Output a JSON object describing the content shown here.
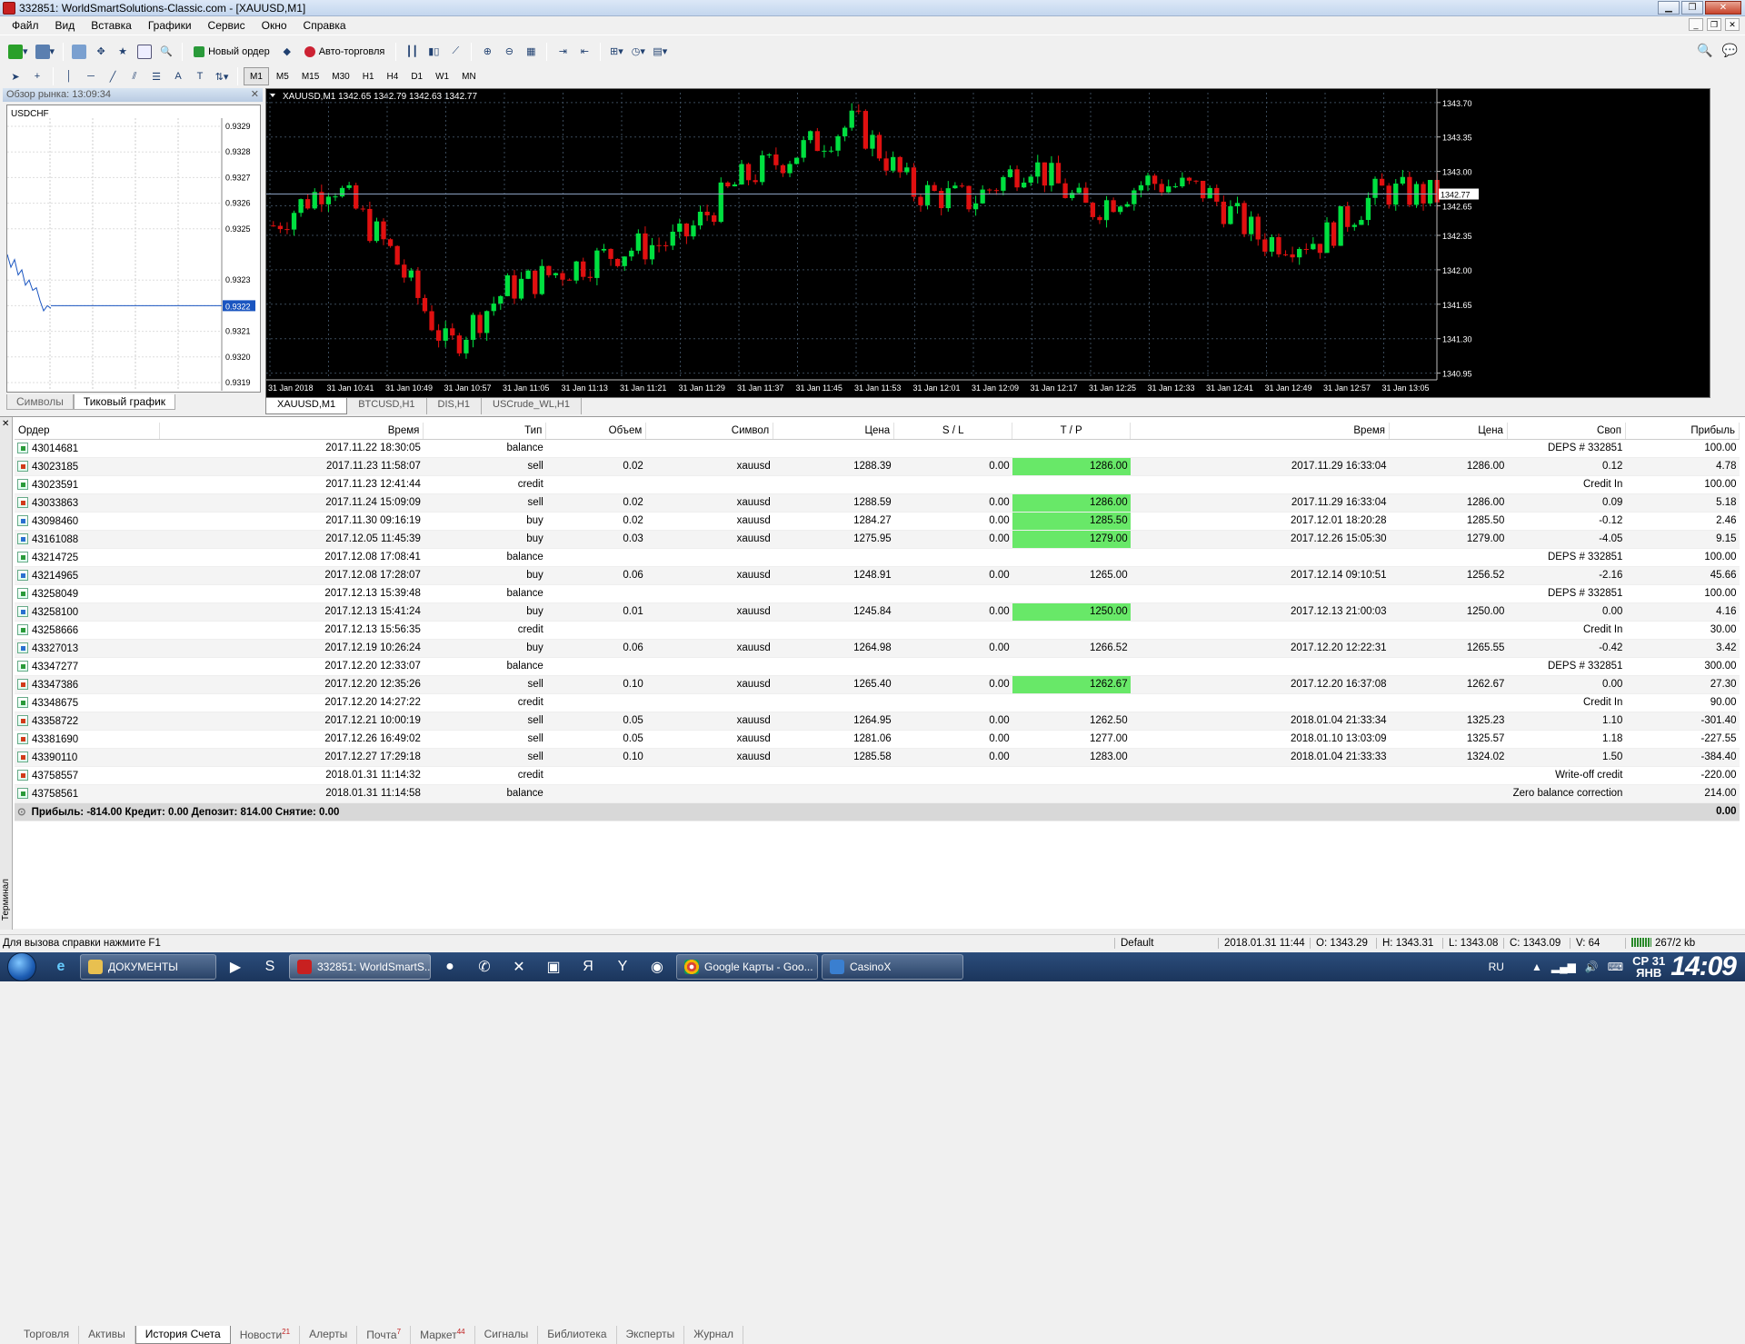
{
  "window": {
    "title": "332851: WorldSmartSolutions-Classic.com - [XAUUSD,M1]"
  },
  "menu": [
    "Файл",
    "Вид",
    "Вставка",
    "Графики",
    "Сервис",
    "Окно",
    "Справка"
  ],
  "toolbar": {
    "new_order": "Новый ордер",
    "auto_trading": "Авто-торговля"
  },
  "timeframes": [
    "M1",
    "M5",
    "M15",
    "M30",
    "H1",
    "H4",
    "D1",
    "W1",
    "MN"
  ],
  "market_watch": {
    "header": "Обзор рынка: 13:09:34",
    "symbol": "USDCHF",
    "price_ticks": [
      "0.9329",
      "0.9328",
      "0.9327",
      "0.9326",
      "0.9325",
      "0.9323",
      "0.9322",
      "0.9321",
      "0.9320",
      "0.9319"
    ],
    "current_price": "0.9322",
    "tabs": [
      "Символы",
      "Тиковый график"
    ]
  },
  "chart": {
    "header": "XAUUSD,M1  1342.65 1342.79 1342.63 1342.77",
    "price_labels": [
      "1343.70",
      "1343.35",
      "1343.00",
      "1342.77",
      "1342.65",
      "1342.35",
      "1342.00",
      "1341.65",
      "1341.30",
      "1340.95"
    ],
    "time_labels": [
      "31 Jan 2018",
      "31 Jan 10:41",
      "31 Jan 10:49",
      "31 Jan 10:57",
      "31 Jan 11:05",
      "31 Jan 11:13",
      "31 Jan 11:21",
      "31 Jan 11:29",
      "31 Jan 11:37",
      "31 Jan 11:45",
      "31 Jan 11:53",
      "31 Jan 12:01",
      "31 Jan 12:09",
      "31 Jan 12:17",
      "31 Jan 12:25",
      "31 Jan 12:33",
      "31 Jan 12:41",
      "31 Jan 12:49",
      "31 Jan 12:57",
      "31 Jan 13:05"
    ],
    "tabs": [
      "XAUUSD,M1",
      "BTCUSD,H1",
      "DIS,H1",
      "USCrude_WL,H1"
    ],
    "colors": {
      "up": "#00e040",
      "down": "#e01010",
      "grid": "#3a4a5a",
      "bid": "#8aa0c0"
    }
  },
  "history": {
    "columns": [
      "Ордер",
      "Время",
      "Тип",
      "Объем",
      "Символ",
      "Цена",
      "S / L",
      "T / P",
      "Время",
      "Цена",
      "Своп",
      "Прибыль"
    ],
    "rows": [
      {
        "order": "43014681",
        "time": "2017.11.22 18:30:05",
        "type": "balance",
        "vol": "",
        "sym": "",
        "price": "",
        "sl": "",
        "tp": "",
        "ctime": "",
        "cprice": "",
        "swap": "DEPS # 332851",
        "profit": "100.00",
        "icon": "bal",
        "hl": false
      },
      {
        "order": "43023185",
        "time": "2017.11.23 11:58:07",
        "type": "sell",
        "vol": "0.02",
        "sym": "xauusd",
        "price": "1288.39",
        "sl": "0.00",
        "tp": "1286.00",
        "ctime": "2017.11.29 16:33:04",
        "cprice": "1286.00",
        "swap": "0.12",
        "profit": "4.78",
        "icon": "sell",
        "hl": true
      },
      {
        "order": "43023591",
        "time": "2017.11.23 12:41:44",
        "type": "credit",
        "vol": "",
        "sym": "",
        "price": "",
        "sl": "",
        "tp": "",
        "ctime": "",
        "cprice": "",
        "swap": "Credit In",
        "profit": "100.00",
        "icon": "bal",
        "hl": false
      },
      {
        "order": "43033863",
        "time": "2017.11.24 15:09:09",
        "type": "sell",
        "vol": "0.02",
        "sym": "xauusd",
        "price": "1288.59",
        "sl": "0.00",
        "tp": "1286.00",
        "ctime": "2017.11.29 16:33:04",
        "cprice": "1286.00",
        "swap": "0.09",
        "profit": "5.18",
        "icon": "sell",
        "hl": true
      },
      {
        "order": "43098460",
        "time": "2017.11.30 09:16:19",
        "type": "buy",
        "vol": "0.02",
        "sym": "xauusd",
        "price": "1284.27",
        "sl": "0.00",
        "tp": "1285.50",
        "ctime": "2017.12.01 18:20:28",
        "cprice": "1285.50",
        "swap": "-0.12",
        "profit": "2.46",
        "icon": "buy",
        "hl": true
      },
      {
        "order": "43161088",
        "time": "2017.12.05 11:45:39",
        "type": "buy",
        "vol": "0.03",
        "sym": "xauusd",
        "price": "1275.95",
        "sl": "0.00",
        "tp": "1279.00",
        "ctime": "2017.12.26 15:05:30",
        "cprice": "1279.00",
        "swap": "-4.05",
        "profit": "9.15",
        "icon": "buy",
        "hl": true
      },
      {
        "order": "43214725",
        "time": "2017.12.08 17:08:41",
        "type": "balance",
        "vol": "",
        "sym": "",
        "price": "",
        "sl": "",
        "tp": "",
        "ctime": "",
        "cprice": "",
        "swap": "DEPS # 332851",
        "profit": "100.00",
        "icon": "bal",
        "hl": false
      },
      {
        "order": "43214965",
        "time": "2017.12.08 17:28:07",
        "type": "buy",
        "vol": "0.06",
        "sym": "xauusd",
        "price": "1248.91",
        "sl": "0.00",
        "tp": "1265.00",
        "ctime": "2017.12.14 09:10:51",
        "cprice": "1256.52",
        "swap": "-2.16",
        "profit": "45.66",
        "icon": "buy",
        "hl": false
      },
      {
        "order": "43258049",
        "time": "2017.12.13 15:39:48",
        "type": "balance",
        "vol": "",
        "sym": "",
        "price": "",
        "sl": "",
        "tp": "",
        "ctime": "",
        "cprice": "",
        "swap": "DEPS # 332851",
        "profit": "100.00",
        "icon": "bal",
        "hl": false
      },
      {
        "order": "43258100",
        "time": "2017.12.13 15:41:24",
        "type": "buy",
        "vol": "0.01",
        "sym": "xauusd",
        "price": "1245.84",
        "sl": "0.00",
        "tp": "1250.00",
        "ctime": "2017.12.13 21:00:03",
        "cprice": "1250.00",
        "swap": "0.00",
        "profit": "4.16",
        "icon": "buy",
        "hl": true
      },
      {
        "order": "43258666",
        "time": "2017.12.13 15:56:35",
        "type": "credit",
        "vol": "",
        "sym": "",
        "price": "",
        "sl": "",
        "tp": "",
        "ctime": "",
        "cprice": "",
        "swap": "Credit In",
        "profit": "30.00",
        "icon": "bal",
        "hl": false
      },
      {
        "order": "43327013",
        "time": "2017.12.19 10:26:24",
        "type": "buy",
        "vol": "0.06",
        "sym": "xauusd",
        "price": "1264.98",
        "sl": "0.00",
        "tp": "1266.52",
        "ctime": "2017.12.20 12:22:31",
        "cprice": "1265.55",
        "swap": "-0.42",
        "profit": "3.42",
        "icon": "buy",
        "hl": false
      },
      {
        "order": "43347277",
        "time": "2017.12.20 12:33:07",
        "type": "balance",
        "vol": "",
        "sym": "",
        "price": "",
        "sl": "",
        "tp": "",
        "ctime": "",
        "cprice": "",
        "swap": "DEPS # 332851",
        "profit": "300.00",
        "icon": "bal",
        "hl": false
      },
      {
        "order": "43347386",
        "time": "2017.12.20 12:35:26",
        "type": "sell",
        "vol": "0.10",
        "sym": "xauusd",
        "price": "1265.40",
        "sl": "0.00",
        "tp": "1262.67",
        "ctime": "2017.12.20 16:37:08",
        "cprice": "1262.67",
        "swap": "0.00",
        "profit": "27.30",
        "icon": "sell",
        "hl": true
      },
      {
        "order": "43348675",
        "time": "2017.12.20 14:27:22",
        "type": "credit",
        "vol": "",
        "sym": "",
        "price": "",
        "sl": "",
        "tp": "",
        "ctime": "",
        "cprice": "",
        "swap": "Credit In",
        "profit": "90.00",
        "icon": "bal",
        "hl": false
      },
      {
        "order": "43358722",
        "time": "2017.12.21 10:00:19",
        "type": "sell",
        "vol": "0.05",
        "sym": "xauusd",
        "price": "1264.95",
        "sl": "0.00",
        "tp": "1262.50",
        "ctime": "2018.01.04 21:33:34",
        "cprice": "1325.23",
        "swap": "1.10",
        "profit": "-301.40",
        "icon": "sell",
        "hl": false
      },
      {
        "order": "43381690",
        "time": "2017.12.26 16:49:02",
        "type": "sell",
        "vol": "0.05",
        "sym": "xauusd",
        "price": "1281.06",
        "sl": "0.00",
        "tp": "1277.00",
        "ctime": "2018.01.10 13:03:09",
        "cprice": "1325.57",
        "swap": "1.18",
        "profit": "-227.55",
        "icon": "sell",
        "hl": false
      },
      {
        "order": "43390110",
        "time": "2017.12.27 17:29:18",
        "type": "sell",
        "vol": "0.10",
        "sym": "xauusd",
        "price": "1285.58",
        "sl": "0.00",
        "tp": "1283.00",
        "ctime": "2018.01.04 21:33:33",
        "cprice": "1324.02",
        "swap": "1.50",
        "profit": "-384.40",
        "icon": "sell",
        "hl": false
      },
      {
        "order": "43758557",
        "time": "2018.01.31 11:14:32",
        "type": "credit",
        "vol": "",
        "sym": "",
        "price": "",
        "sl": "",
        "tp": "",
        "ctime": "",
        "cprice": "",
        "swap": "Write-off credit",
        "profit": "-220.00",
        "icon": "sell",
        "hl": false
      },
      {
        "order": "43758561",
        "time": "2018.01.31 11:14:58",
        "type": "balance",
        "vol": "",
        "sym": "",
        "price": "",
        "sl": "",
        "tp": "",
        "ctime": "",
        "cprice": "",
        "swap": "Zero balance correction",
        "profit": "214.00",
        "icon": "bal",
        "hl": false
      }
    ],
    "summary": "Прибыль: -814.00  Кредит: 0.00  Депозит: 814.00  Снятие: 0.00",
    "summary_total": "0.00"
  },
  "terminal_label": "Терминал",
  "terminal_tabs": [
    {
      "label": "Торговля",
      "badge": ""
    },
    {
      "label": "Активы",
      "badge": ""
    },
    {
      "label": "История Счета",
      "badge": ""
    },
    {
      "label": "Новости",
      "badge": "21"
    },
    {
      "label": "Алерты",
      "badge": ""
    },
    {
      "label": "Почта",
      "badge": "7"
    },
    {
      "label": "Маркет",
      "badge": "44"
    },
    {
      "label": "Сигналы",
      "badge": ""
    },
    {
      "label": "Библиотека",
      "badge": ""
    },
    {
      "label": "Эксперты",
      "badge": ""
    },
    {
      "label": "Журнал",
      "badge": ""
    }
  ],
  "status": {
    "help": "Для вызова справки нажмите F1",
    "profile": "Default",
    "datetime": "2018.01.31 11:44",
    "open": "O: 1343.29",
    "high": "H: 1343.31",
    "low": "L: 1343.08",
    "close": "C: 1343.09",
    "volume": "V: 64",
    "traffic": "267/2 kb"
  },
  "taskbar": {
    "tasks": [
      "ДОКУМЕНТЫ",
      "332851: WorldSmartS...",
      "Google Карты - Goo...",
      "CasinoX"
    ],
    "lang": "RU",
    "day": "СР",
    "date": "31",
    "month": "ЯНВ",
    "time": "14:09"
  }
}
